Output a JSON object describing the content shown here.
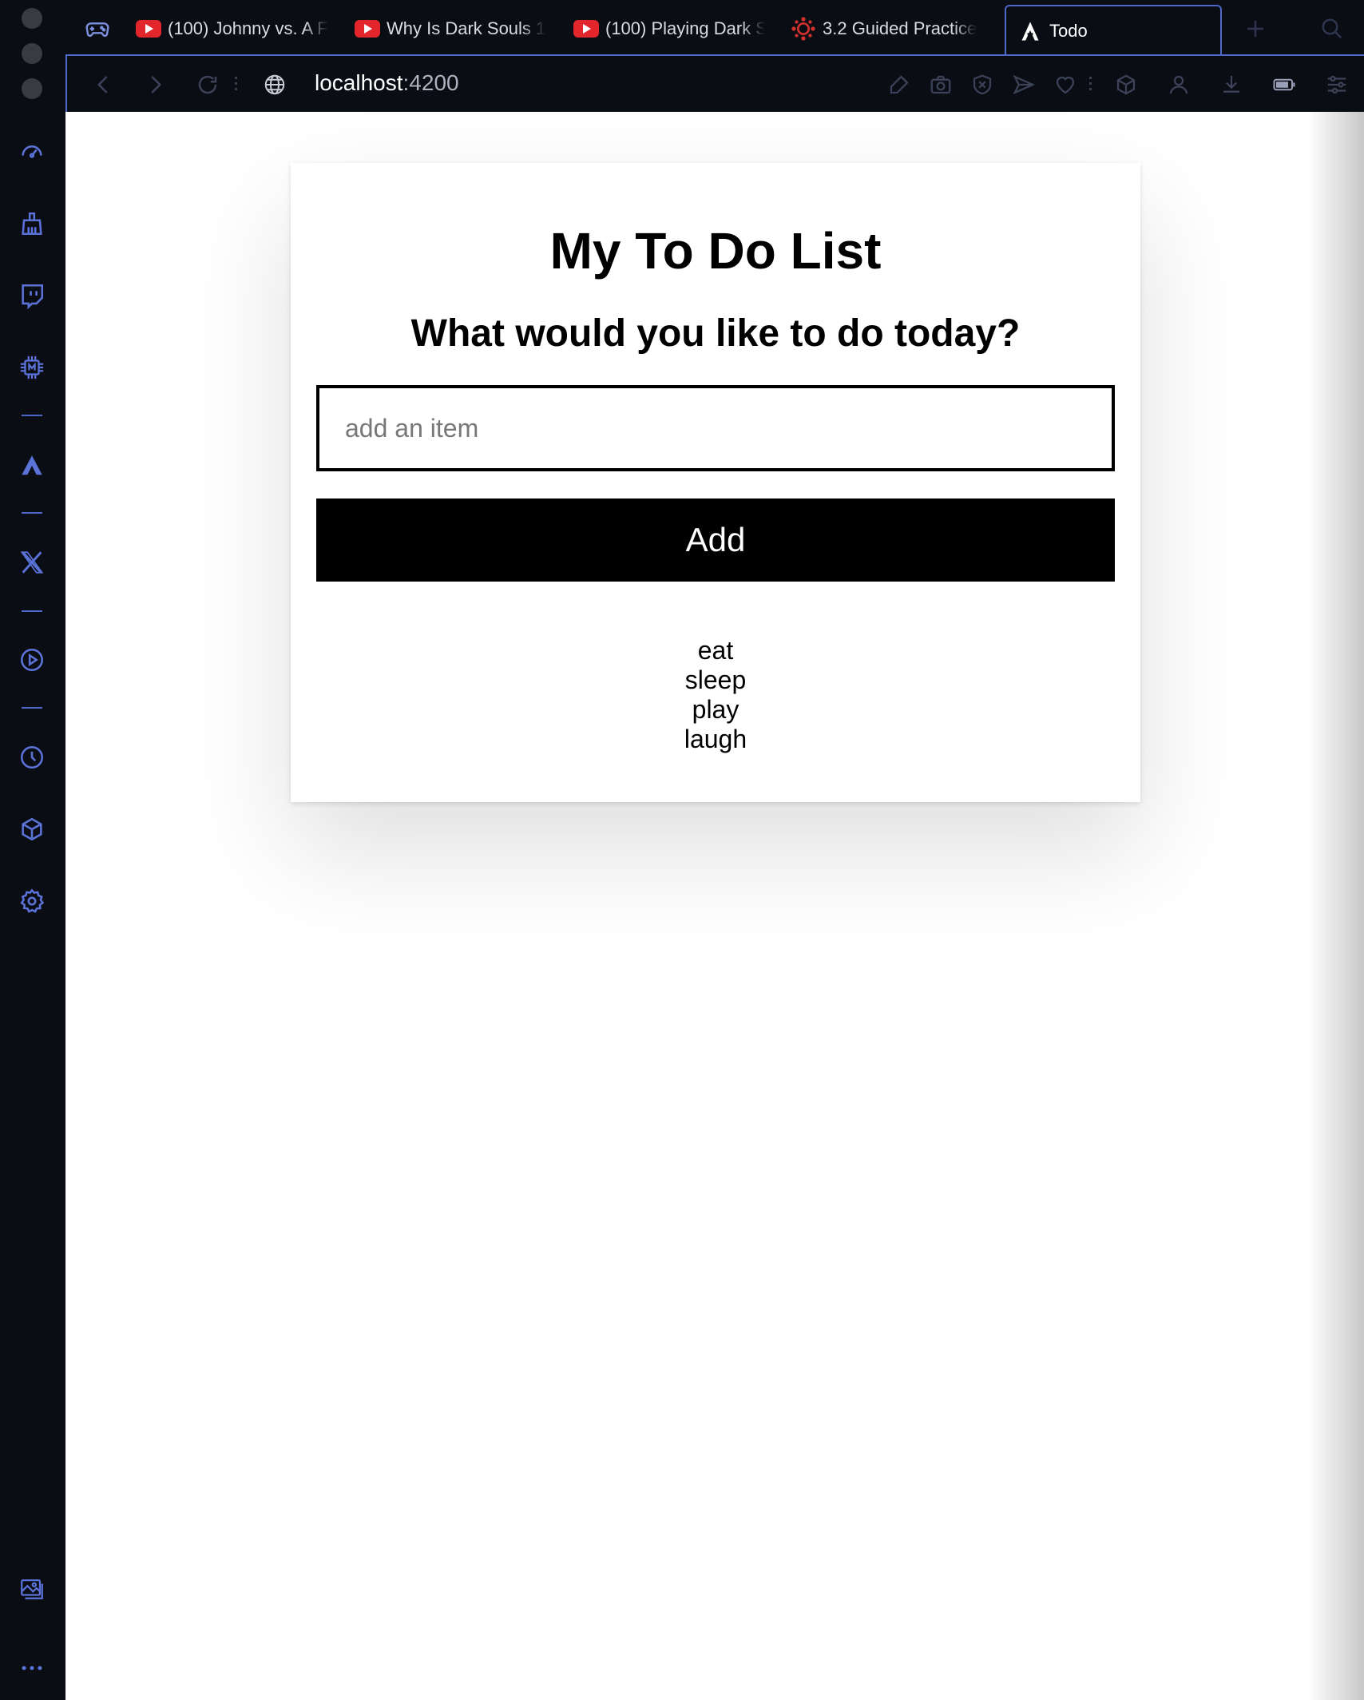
{
  "browser": {
    "tabs": [
      {
        "label": "(100) Johnny vs. A F",
        "icon": "youtube-icon"
      },
      {
        "label": "Why Is Dark Souls 1",
        "icon": "youtube-icon"
      },
      {
        "label": "(100) Playing Dark S",
        "icon": "youtube-icon"
      },
      {
        "label": "3.2 Guided Practice",
        "icon": "canvas-icon"
      },
      {
        "label": "Todo",
        "icon": "angular-icon",
        "active": true
      }
    ],
    "address": {
      "host": "localhost",
      "port": ":4200"
    },
    "accent": "#4f67c8"
  },
  "sidebar": {
    "items": [
      "speed-dial-icon",
      "broom-icon",
      "twitch-icon",
      "memory-chip-icon",
      "aria-icon",
      "x-icon",
      "player-icon",
      "history-icon",
      "cube-icon",
      "settings-icon",
      "gallery-icon",
      "more-icon"
    ]
  },
  "app": {
    "title": "My To Do List",
    "subtitle": "What would you like to do today?",
    "input_placeholder": "add an item",
    "add_label": "Add",
    "items": [
      "eat",
      "sleep",
      "play",
      "laugh"
    ]
  }
}
